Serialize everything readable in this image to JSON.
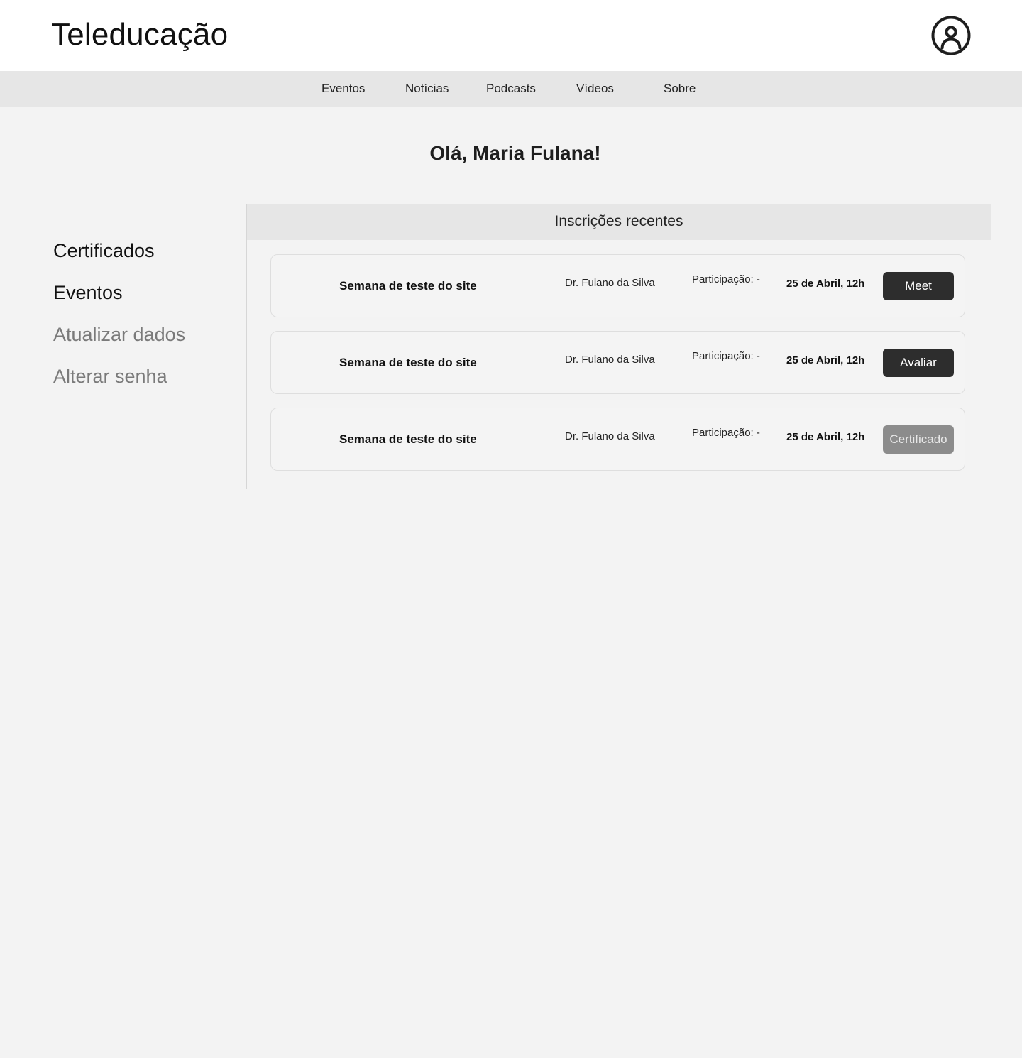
{
  "header": {
    "brand": "Teleducação",
    "profile_icon": "user-circle-icon"
  },
  "nav": {
    "items": [
      {
        "label": "Eventos"
      },
      {
        "label": "Notícias"
      },
      {
        "label": "Podcasts"
      },
      {
        "label": "Vídeos"
      },
      {
        "label": "Sobre"
      }
    ]
  },
  "greeting": "Olá, Maria Fulana!",
  "sidebar": {
    "items": [
      {
        "label": "Certificados",
        "state": "active"
      },
      {
        "label": "Eventos",
        "state": "active"
      },
      {
        "label": "Atualizar dados",
        "state": "muted"
      },
      {
        "label": "Alterar senha",
        "state": "muted"
      }
    ]
  },
  "registrations": {
    "title": "Inscrições recentes",
    "items": [
      {
        "event": "Semana de teste do site",
        "speaker": "Dr. Fulano da Silva",
        "participation": "Participação: -",
        "date": "25 de Abril, 12h",
        "action": "Meet",
        "action_enabled": true
      },
      {
        "event": "Semana de teste do site",
        "speaker": "Dr. Fulano da Silva",
        "participation": "Participação: -",
        "date": "25 de Abril, 12h",
        "action": "Avaliar",
        "action_enabled": true
      },
      {
        "event": "Semana de teste do site",
        "speaker": "Dr. Fulano da Silva",
        "participation": "Participação: -",
        "date": "25 de Abril, 12h",
        "action": "Certificado",
        "action_enabled": false
      }
    ]
  },
  "colors": {
    "page_background": "#f3f3f3",
    "header_background": "#ffffff",
    "nav_background": "#e6e6e6",
    "button_primary": "#2d2d2d",
    "button_disabled": "#8c8c8c",
    "muted_text": "#7a7a7a"
  }
}
